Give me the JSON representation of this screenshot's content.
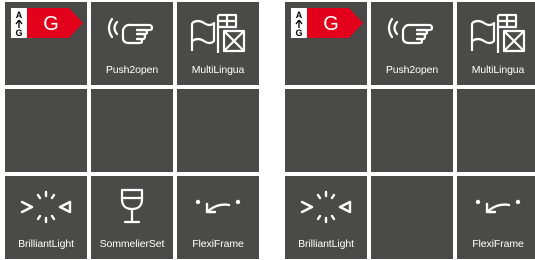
{
  "panels": [
    {
      "tiles": [
        {
          "id": "energy",
          "energy": {
            "arrow_text_top": "A",
            "arrow_text_bottom": "G",
            "grade": "G"
          },
          "label": "",
          "icon": "energy-class-icon"
        },
        {
          "id": "push2open",
          "label": "Push2open",
          "icon": "push-hand-icon"
        },
        {
          "id": "multilingua",
          "label": "MultiLingua",
          "icon": "flags-icon"
        },
        {
          "id": "empty1",
          "label": ""
        },
        {
          "id": "empty2",
          "label": ""
        },
        {
          "id": "empty3",
          "label": ""
        },
        {
          "id": "brilliantlight",
          "label": "BrilliantLight",
          "icon": "light-icon"
        },
        {
          "id": "sommelierset",
          "label": "SommelierSet",
          "icon": "wine-glass-icon"
        },
        {
          "id": "flexiframe",
          "label": "FlexiFrame",
          "icon": "flexi-frame-icon"
        }
      ]
    },
    {
      "tiles": [
        {
          "id": "energy",
          "energy": {
            "arrow_text_top": "A",
            "arrow_text_bottom": "G",
            "grade": "G"
          },
          "label": "",
          "icon": "energy-class-icon"
        },
        {
          "id": "push2open",
          "label": "Push2open",
          "icon": "push-hand-icon"
        },
        {
          "id": "multilingua",
          "label": "MultiLingua",
          "icon": "flags-icon"
        },
        {
          "id": "empty1",
          "label": ""
        },
        {
          "id": "empty2",
          "label": ""
        },
        {
          "id": "empty3",
          "label": ""
        },
        {
          "id": "brilliantlight",
          "label": "BrilliantLight",
          "icon": "light-icon"
        },
        {
          "id": "empty4",
          "label": ""
        },
        {
          "id": "flexiframe",
          "label": "FlexiFrame",
          "icon": "flexi-frame-icon"
        }
      ]
    }
  ],
  "colors": {
    "tile": "#4a4a49",
    "energy_red": "#e2001a",
    "icon": "#ffffff"
  }
}
